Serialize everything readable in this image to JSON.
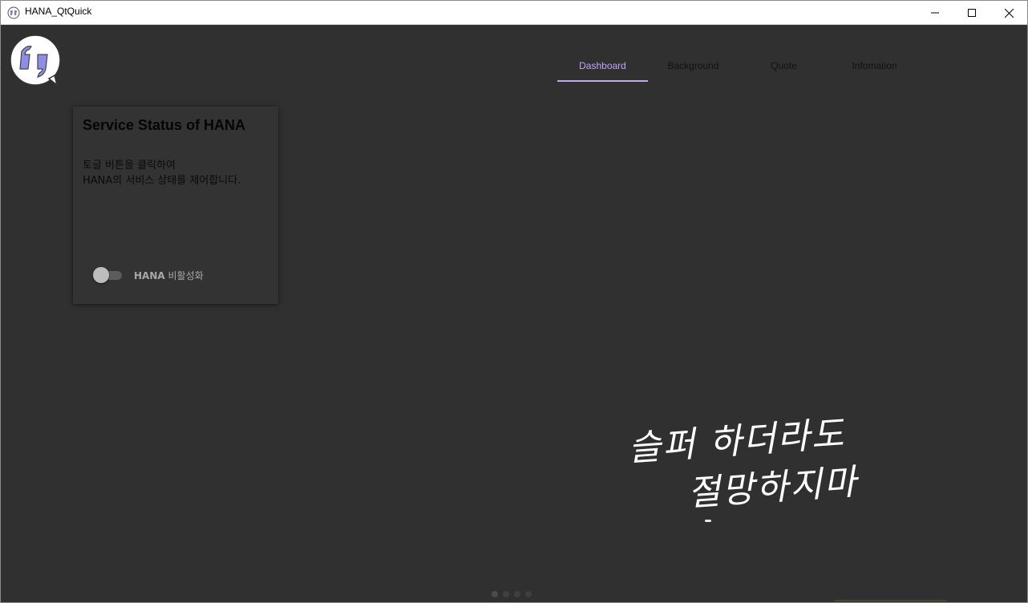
{
  "window": {
    "title": "HANA_QtQuick",
    "controls": {
      "minimize_icon": "minimize-icon",
      "maximize_icon": "maximize-icon",
      "close_icon": "close-icon"
    }
  },
  "logo": {
    "icon": "quote-bubble-icon"
  },
  "tabs": [
    {
      "label": "Dashboard",
      "active": true
    },
    {
      "label": "Background",
      "active": false
    },
    {
      "label": "Quote",
      "active": false
    },
    {
      "label": "Infomation",
      "active": false
    }
  ],
  "card": {
    "title": "Service Status of HANA",
    "description_line1": "토글 버튼을 클릭하여",
    "description_line2": "HANA의 서비스 상태를 제어합니다.",
    "switch_label_bold": "HANA",
    "switch_label_rest": " 비활성화",
    "switch_on": false
  },
  "quote_image": {
    "line1": "슬퍼 하더라도",
    "line2": "절망하지마"
  },
  "page_indicator": {
    "count": 4,
    "current": 1
  },
  "colors": {
    "background": "#303030",
    "accent": "#c3a6f0",
    "card": "#333333"
  }
}
